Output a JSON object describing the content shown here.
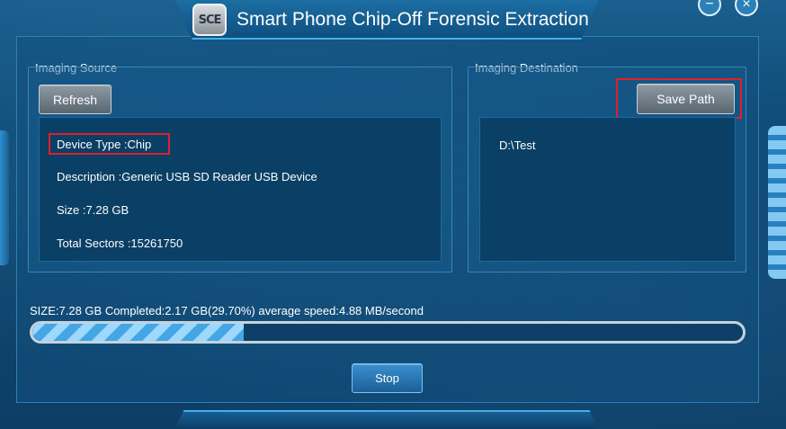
{
  "window": {
    "logo_text": "SCE",
    "title": "Smart Phone Chip-Off Forensic Extraction",
    "minimize_symbol": "−",
    "close_symbol": "×"
  },
  "source": {
    "label": "Imaging Source",
    "refresh_label": "Refresh",
    "device_type": "Device Type :Chip",
    "description": "Description :Generic USB  SD Reader USB Device",
    "size": "Size :7.28 GB",
    "total_sectors": "Total Sectors :15261750"
  },
  "destination": {
    "label": "Imaging Destination",
    "save_path_label": "Save Path",
    "path": "D:\\Test"
  },
  "progress": {
    "status_text": "SIZE:7.28 GB Completed:2.17 GB(29.70%) average speed:4.88 MB/second",
    "percent": 29.7
  },
  "actions": {
    "stop_label": "Stop"
  },
  "colors": {
    "highlight_box": "#e0202a",
    "accent": "#3fb2e8"
  }
}
